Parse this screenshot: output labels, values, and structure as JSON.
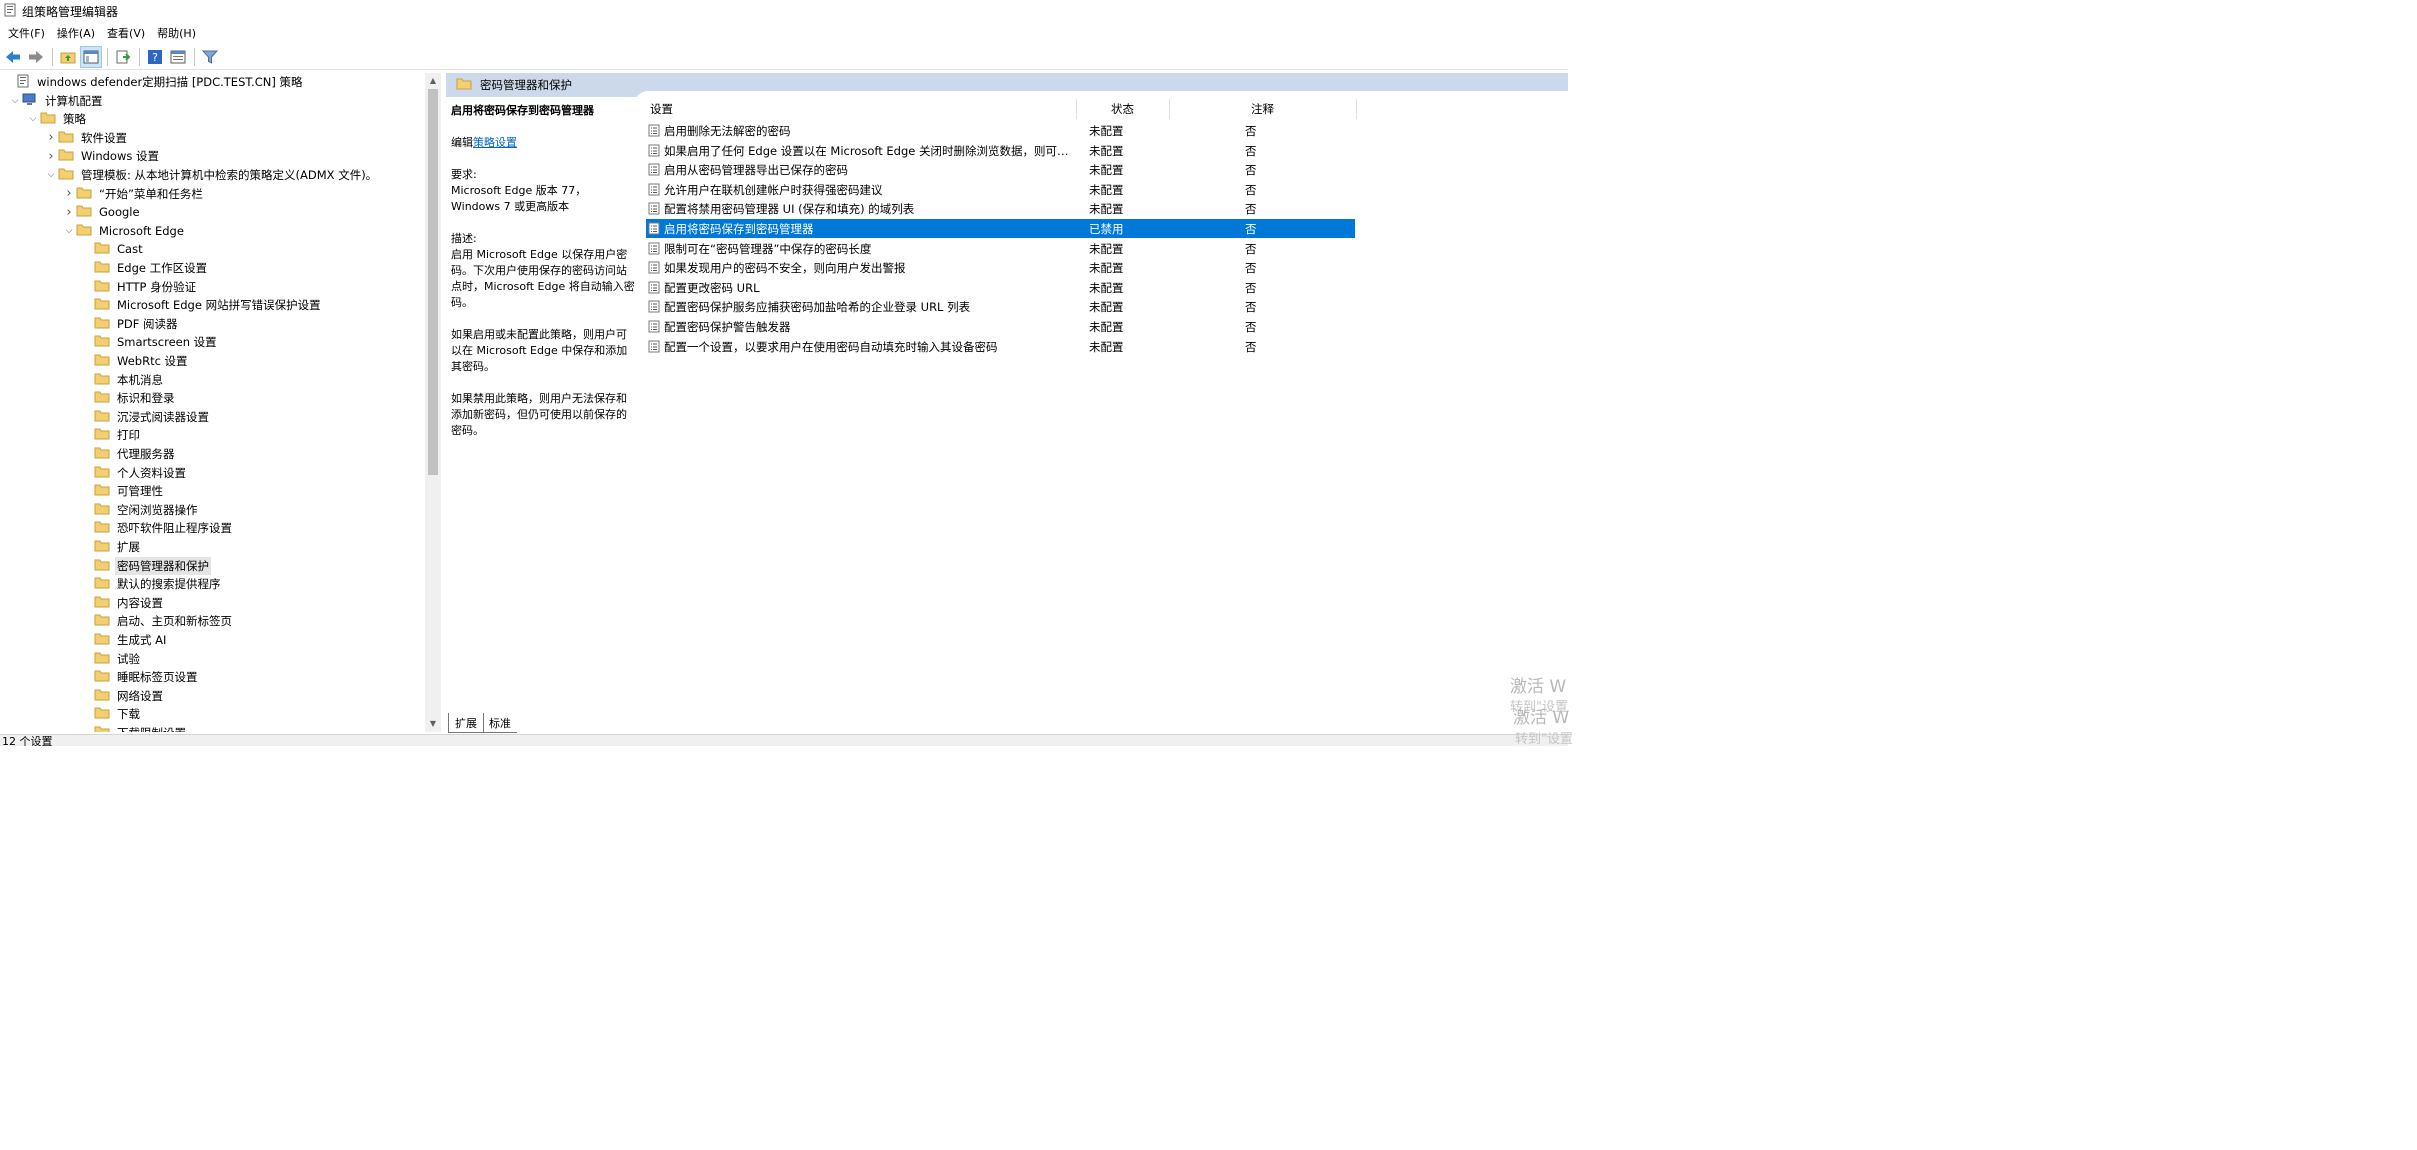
{
  "window": {
    "title": "组策略管理编辑器",
    "icon": "policy-app-icon"
  },
  "menu": [
    "文件(F)",
    "操作(A)",
    "查看(V)",
    "帮助(H)"
  ],
  "tree": [
    {
      "label": "windows defender定期扫描 [PDC.TEST.CN] 策略",
      "icon": "policy-doc-icon",
      "arrow": ""
    },
    {
      "label": "计算机配置",
      "icon": "computer-icon",
      "arrow": "down"
    },
    {
      "label": "策略",
      "icon": "folder-icon",
      "arrow": "down"
    },
    {
      "label": "软件设置",
      "icon": "folder-icon",
      "arrow": "right"
    },
    {
      "label": "Windows 设置",
      "icon": "folder-icon",
      "arrow": "right"
    },
    {
      "label": "管理模板: 从本地计算机中检索的策略定义(ADMX 文件)。",
      "icon": "folder-icon",
      "arrow": "down"
    },
    {
      "label": "“开始”菜单和任务栏",
      "icon": "folder-icon",
      "arrow": "right"
    },
    {
      "label": "Google",
      "icon": "folder-icon",
      "arrow": "right"
    },
    {
      "label": "Microsoft Edge",
      "icon": "folder-icon",
      "arrow": "down"
    },
    {
      "label": "Cast",
      "icon": "folder-icon",
      "arrow": ""
    },
    {
      "label": "Edge 工作区设置",
      "icon": "folder-icon",
      "arrow": ""
    },
    {
      "label": "HTTP 身份验证",
      "icon": "folder-icon",
      "arrow": ""
    },
    {
      "label": "Microsoft Edge 网站拼写错误保护设置",
      "icon": "folder-icon",
      "arrow": ""
    },
    {
      "label": "PDF 阅读器",
      "icon": "folder-icon",
      "arrow": ""
    },
    {
      "label": "Smartscreen 设置",
      "icon": "folder-icon",
      "arrow": ""
    },
    {
      "label": "WebRtc 设置",
      "icon": "folder-icon",
      "arrow": ""
    },
    {
      "label": "本机消息",
      "icon": "folder-icon",
      "arrow": ""
    },
    {
      "label": "标识和登录",
      "icon": "folder-icon",
      "arrow": ""
    },
    {
      "label": "沉浸式阅读器设置",
      "icon": "folder-icon",
      "arrow": ""
    },
    {
      "label": "打印",
      "icon": "folder-icon",
      "arrow": ""
    },
    {
      "label": "代理服务器",
      "icon": "folder-icon",
      "arrow": ""
    },
    {
      "label": "个人资料设置",
      "icon": "folder-icon",
      "arrow": ""
    },
    {
      "label": "可管理性",
      "icon": "folder-icon",
      "arrow": ""
    },
    {
      "label": "空闲浏览器操作",
      "icon": "folder-icon",
      "arrow": ""
    },
    {
      "label": "恐吓软件阻止程序设置",
      "icon": "folder-icon",
      "arrow": ""
    },
    {
      "label": "扩展",
      "icon": "folder-icon",
      "arrow": ""
    },
    {
      "label": "密码管理器和保护",
      "icon": "folder-open-icon",
      "arrow": "",
      "selected": true
    },
    {
      "label": "默认的搜索提供程序",
      "icon": "folder-icon",
      "arrow": ""
    },
    {
      "label": "内容设置",
      "icon": "folder-icon",
      "arrow": ""
    },
    {
      "label": "启动、主页和新标签页",
      "icon": "folder-icon",
      "arrow": ""
    },
    {
      "label": "生成式 AI",
      "icon": "folder-icon",
      "arrow": ""
    },
    {
      "label": "试验",
      "icon": "folder-icon",
      "arrow": ""
    },
    {
      "label": "睡眠标签页设置",
      "icon": "folder-icon",
      "arrow": ""
    },
    {
      "label": "网络设置",
      "icon": "folder-icon",
      "arrow": ""
    },
    {
      "label": "下载",
      "icon": "folder-icon",
      "arrow": ""
    },
    {
      "label": "下载限制设置",
      "icon": "folder-icon",
      "arrow": ""
    }
  ],
  "right_header": "密码管理器和保护",
  "description": {
    "title": "启用将密码保存到密码管理器",
    "edit_prefix": "编辑",
    "edit_link": "策略设置",
    "req_label": "要求:",
    "req_text": "Microsoft Edge 版本 77，Windows 7 或更高版本",
    "desc_label": "描述:",
    "p1": "启用 Microsoft Edge 以保存用户密码。下次用户使用保存的密码访问站点时，Microsoft Edge 将自动输入密码。",
    "p2": "如果启用或未配置此策略，则用户可以在 Microsoft Edge 中保存和添加其密码。",
    "p3": "如果禁用此策略，则用户无法保存和添加新密码，但仍可使用以前保存的密码。"
  },
  "columns": {
    "setting": "设置",
    "state": "状态",
    "comment": "注释"
  },
  "rows": [
    {
      "setting": "启用删除无法解密的密码",
      "state": "未配置",
      "comment": "否"
    },
    {
      "setting": "如果启用了任何 Edge 设置以在 Microsoft Edge 关闭时删除浏览数据，则可防...",
      "state": "未配置",
      "comment": "否"
    },
    {
      "setting": "启用从密码管理器导出已保存的密码",
      "state": "未配置",
      "comment": "否"
    },
    {
      "setting": "允许用户在联机创建帐户时获得强密码建议",
      "state": "未配置",
      "comment": "否"
    },
    {
      "setting": "配置将禁用密码管理器 UI (保存和填充) 的域列表",
      "state": "未配置",
      "comment": "否"
    },
    {
      "setting": "启用将密码保存到密码管理器",
      "state": "已禁用",
      "comment": "否",
      "selected": true
    },
    {
      "setting": "限制可在“密码管理器”中保存的密码长度",
      "state": "未配置",
      "comment": "否"
    },
    {
      "setting": "如果发现用户的密码不安全，则向用户发出警报",
      "state": "未配置",
      "comment": "否"
    },
    {
      "setting": "配置更改密码 URL",
      "state": "未配置",
      "comment": "否"
    },
    {
      "setting": "配置密码保护服务应捕获密码加盐哈希的企业登录 URL 列表",
      "state": "未配置",
      "comment": "否"
    },
    {
      "setting": "配置密码保护警告触发器",
      "state": "未配置",
      "comment": "否"
    },
    {
      "setting": "配置一个设置，以要求用户在使用密码自动填充时输入其设备密码",
      "state": "未配置",
      "comment": "否"
    }
  ],
  "tabs": [
    "扩展",
    "标准"
  ],
  "status": "12 个设置",
  "watermark": {
    "line1": "激活 W",
    "line2": "转到\"设置"
  },
  "colors": {
    "selection": "#0078d7",
    "header": "#ccd9ea",
    "folder": "#f3cf72",
    "link": "#0066cc"
  }
}
